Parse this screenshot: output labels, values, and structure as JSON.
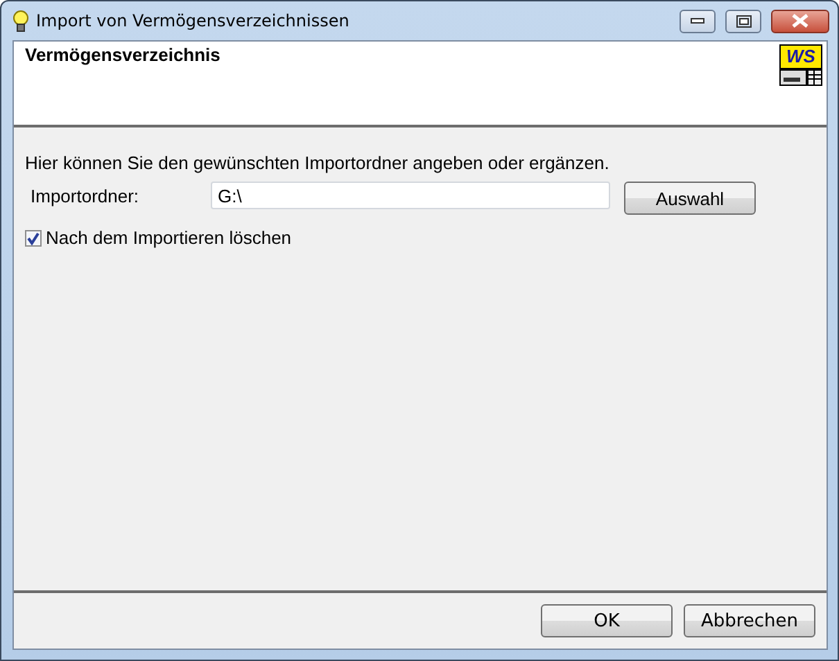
{
  "window": {
    "title": "Import von Vermögensverzeichnissen"
  },
  "header": {
    "title": "Vermögensverzeichnis",
    "logo": "WS"
  },
  "instruction": "Hier können Sie den gewünschten Importordner angeben oder ergänzen.",
  "folder": {
    "label": "Importordner:",
    "value": "G:\\",
    "button": "Auswahl"
  },
  "delete_option": {
    "label": "Nach dem Importieren löschen",
    "checked": true
  },
  "buttons": [
    "OK",
    "Abbrechen"
  ]
}
